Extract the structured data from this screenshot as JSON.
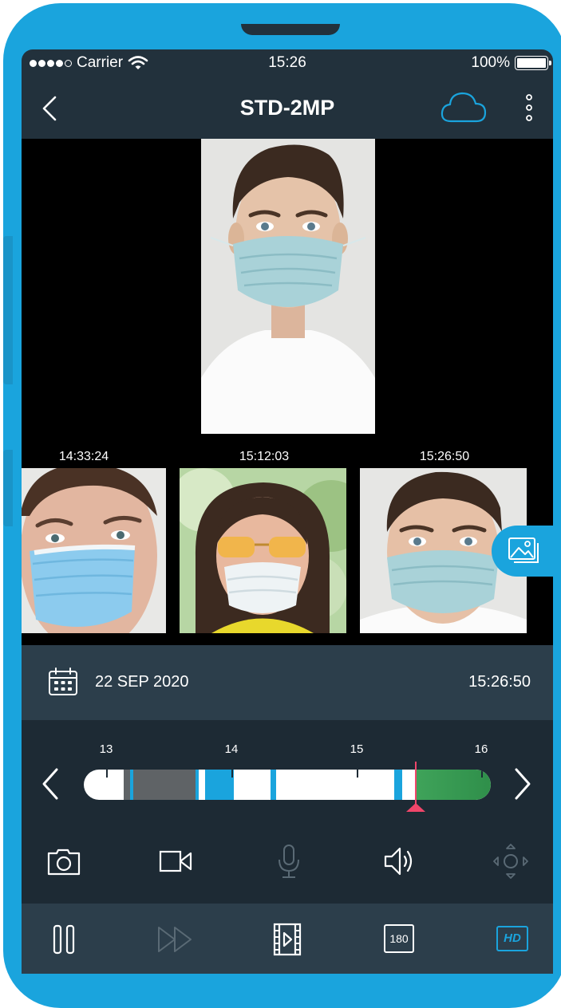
{
  "statusbar": {
    "carrier": "Carrier",
    "time": "15:26",
    "battery": "100%"
  },
  "header": {
    "title": "STD-2MP"
  },
  "thumbnails": [
    {
      "time": "14:33:24"
    },
    {
      "time": "15:12:03"
    },
    {
      "time": "15:26:50"
    }
  ],
  "datebar": {
    "date": "22 SEP 2020",
    "time": "15:26:50"
  },
  "timeline": {
    "ticks": [
      "13",
      "14",
      "15",
      "16"
    ],
    "playhead_time": "15:26:50"
  },
  "controls": {
    "resolution_label": "180",
    "hd_label": "HD"
  },
  "colors": {
    "accent": "#1aa4dd",
    "background": "#22313c",
    "playhead": "#f0466a",
    "recorded": "#3fa35a"
  },
  "icons": [
    "back-icon",
    "cloud-icon",
    "more-icon",
    "gallery-icon",
    "calendar-icon",
    "prev-icon",
    "next-icon",
    "snapshot-icon",
    "record-icon",
    "mic-icon",
    "speaker-icon",
    "ptz-icon",
    "pause-icon",
    "fast-forward-icon",
    "clip-icon"
  ]
}
